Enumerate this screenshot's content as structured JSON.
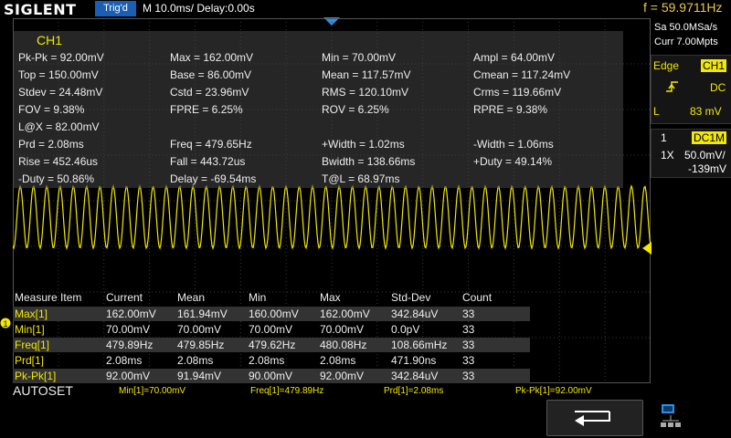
{
  "header": {
    "brand": "SIGLENT",
    "trig_status": "Trig'd",
    "timebase": "M 10.0ms/ Delay:0.00s",
    "frequency": "f = 59.9711Hz"
  },
  "acquisition": {
    "sample_rate": "Sa 50.0MSa/s",
    "memory": "Curr 7.00Mpts"
  },
  "trigger": {
    "type": "Edge",
    "source": "CH1",
    "slope_icon": "rising-edge-icon",
    "coupling": "DC",
    "level_label": "L",
    "level": "83 mV"
  },
  "channel": {
    "number": "1",
    "coupling": "DC1M",
    "probe": "1X",
    "scale": "50.0mV/",
    "offset": "-139mV"
  },
  "overlay": {
    "channel": "CH1",
    "rows": [
      [
        "Pk-Pk = 92.00mV",
        "Max = 162.00mV",
        "Min = 70.00mV",
        "Ampl = 64.00mV"
      ],
      [
        "Top = 150.00mV",
        "Base = 86.00mV",
        "Mean = 117.57mV",
        "Cmean = 117.24mV"
      ],
      [
        "Stdev = 24.48mV",
        "Cstd = 23.96mV",
        "RMS = 120.10mV",
        "Crms = 119.66mV"
      ],
      [
        "FOV = 9.38%",
        "FPRE = 6.25%",
        "ROV = 6.25%",
        "RPRE = 9.38%"
      ],
      [
        "L@X = 82.00mV",
        "",
        "",
        ""
      ],
      [
        "Prd = 2.08ms",
        "Freq = 479.65Hz",
        "+Width = 1.02ms",
        "-Width = 1.06ms"
      ],
      [
        "Rise = 452.46us",
        "Fall = 443.72us",
        "Bwidth = 138.66ms",
        "+Duty = 49.14%"
      ],
      [
        "-Duty = 50.86%",
        "Delay = -69.54ms",
        "T@L = 68.97ms",
        ""
      ]
    ]
  },
  "table": {
    "headers": [
      "Measure Item",
      "Current",
      "Mean",
      "Min",
      "Max",
      "Std-Dev",
      "Count"
    ],
    "rows": [
      [
        "Max[1]",
        "162.00mV",
        "161.94mV",
        "160.00mV",
        "162.00mV",
        "342.84uV",
        "33"
      ],
      [
        "Min[1]",
        "70.00mV",
        "70.00mV",
        "70.00mV",
        "70.00mV",
        "0.0pV",
        "33"
      ],
      [
        "Freq[1]",
        "479.89Hz",
        "479.85Hz",
        "479.62Hz",
        "480.08Hz",
        "108.66mHz",
        "33"
      ],
      [
        "Prd[1]",
        "2.08ms",
        "2.08ms",
        "2.08ms",
        "2.08ms",
        "471.90ns",
        "33"
      ],
      [
        "Pk-Pk[1]",
        "92.00mV",
        "91.94mV",
        "90.00mV",
        "92.00mV",
        "342.84uV",
        "33"
      ]
    ]
  },
  "status": {
    "autoset": "AUTOSET",
    "items": [
      "Min[1]=70.00mV",
      "Freq[1]=479.89Hz",
      "Prd[1]=2.08ms",
      "Pk-Pk[1]=92.00mV"
    ]
  },
  "markers": {
    "ch1": "1"
  },
  "colors": {
    "ch1": "#f2e800",
    "trig_blue": "#1a5fb4"
  }
}
